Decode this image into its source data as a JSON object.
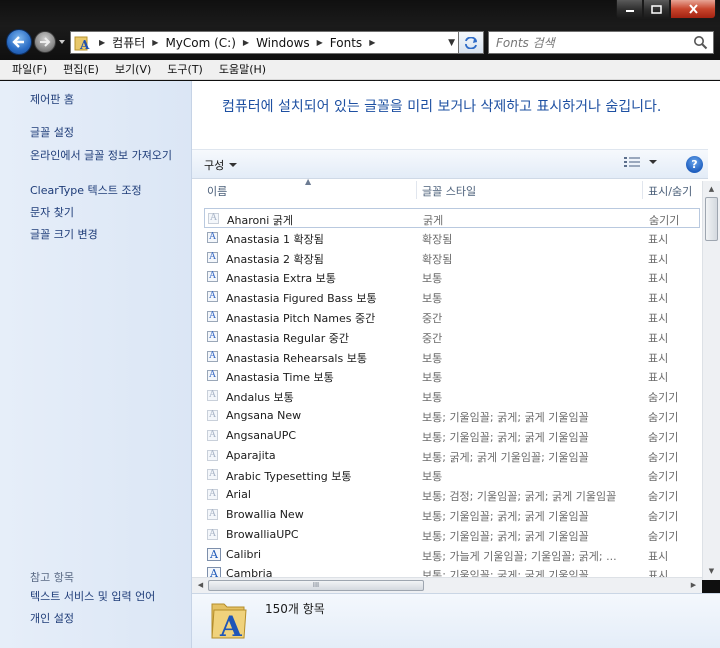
{
  "address": {
    "crumbs": [
      "컴퓨터",
      "MyCom (C:)",
      "Windows",
      "Fonts"
    ]
  },
  "search": {
    "placeholder": "Fonts 검색"
  },
  "menu": [
    "파일(F)",
    "편집(E)",
    "보기(V)",
    "도구(T)",
    "도움말(H)"
  ],
  "sidebar": {
    "tasks": [
      "제어판 홈",
      "글꼴 설정",
      "온라인에서 글꼴 정보 가져오기",
      "ClearType 텍스트 조정",
      "문자 찾기",
      "글꼴 크기 변경"
    ],
    "see_also_label": "참고 항목",
    "see_also": [
      "텍스트 서비스 및 입력 언어",
      "개인 설정"
    ]
  },
  "main": {
    "description": "컴퓨터에 설치되어 있는 글꼴을 미리 보거나 삭제하고 표시하거나 숨깁니다.",
    "organize_label": "구성",
    "help_label": "?",
    "columns": [
      "이름",
      "글꼴 스타일",
      "표시/숨기"
    ]
  },
  "fonts": [
    {
      "name": "Aharoni 굵게",
      "style": "굵게",
      "show": "숨기기",
      "icon": "opentype"
    },
    {
      "name": "Anastasia 1 확장됨",
      "style": "확장됨",
      "show": "표시",
      "icon": "font-a"
    },
    {
      "name": "Anastasia 2 확장됨",
      "style": "확장됨",
      "show": "표시",
      "icon": "font-a"
    },
    {
      "name": "Anastasia Extra 보통",
      "style": "보통",
      "show": "표시",
      "icon": "font-a"
    },
    {
      "name": "Anastasia Figured Bass 보통",
      "style": "보통",
      "show": "표시",
      "icon": "font-a"
    },
    {
      "name": "Anastasia Pitch Names 중간",
      "style": "중간",
      "show": "표시",
      "icon": "font-a"
    },
    {
      "name": "Anastasia Regular 중간",
      "style": "중간",
      "show": "표시",
      "icon": "font-a"
    },
    {
      "name": "Anastasia Rehearsals 보통",
      "style": "보통",
      "show": "표시",
      "icon": "font-a"
    },
    {
      "name": "Anastasia Time 보통",
      "style": "보통",
      "show": "표시",
      "icon": "font-a"
    },
    {
      "name": "Andalus 보통",
      "style": "보통",
      "show": "숨기기",
      "icon": "opentype"
    },
    {
      "name": "Angsana New",
      "style": "보통; 기울임꼴; 굵게; 굵게 기울임꼴",
      "show": "숨기기",
      "icon": "opentype"
    },
    {
      "name": "AngsanaUPC",
      "style": "보통; 기울임꼴; 굵게; 굵게 기울임꼴",
      "show": "숨기기",
      "icon": "opentype"
    },
    {
      "name": "Aparajita",
      "style": "보통; 굵게; 굵게 기울임꼴; 기울임꼴",
      "show": "숨기기",
      "icon": "opentype"
    },
    {
      "name": "Arabic Typesetting 보통",
      "style": "보통",
      "show": "숨기기",
      "icon": "opentype"
    },
    {
      "name": "Arial",
      "style": "보통; 검정; 기울임꼴; 굵게; 굵게 기울임꼴",
      "show": "숨기기",
      "icon": "opentype"
    },
    {
      "name": "Browallia New",
      "style": "보통; 기울임꼴; 굵게; 굵게 기울임꼴",
      "show": "숨기기",
      "icon": "opentype"
    },
    {
      "name": "BrowalliaUPC",
      "style": "보통; 기울임꼴; 굵게; 굵게 기울임꼴",
      "show": "숨기기",
      "icon": "opentype"
    },
    {
      "name": "Calibri",
      "style": "보통; 가늘게 기울임꼴; 기울임꼴; 굵게; ...",
      "show": "표시",
      "icon": "font-big"
    },
    {
      "name": "Cambria",
      "style": "보통; 기울임꼴; 굵게; 굵게 기울임꼴",
      "show": "표시",
      "icon": "font-big"
    }
  ],
  "details": {
    "count": "150개 항목"
  },
  "scroll": {
    "h_thumb_grip": "III"
  }
}
